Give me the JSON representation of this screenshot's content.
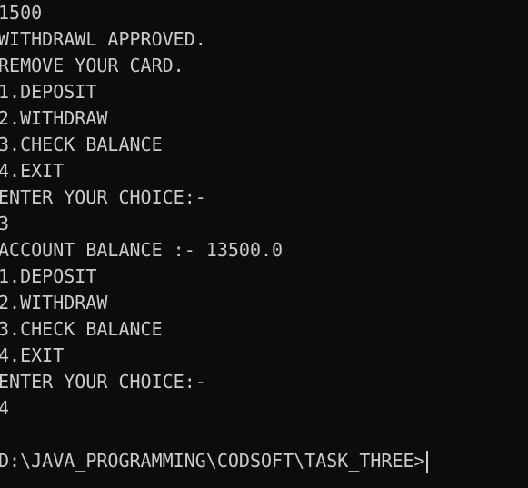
{
  "terminal": {
    "lines_before_prompt": [
      "1500",
      "WITHDRAWL APPROVED.",
      "REMOVE YOUR CARD.",
      "1.DEPOSIT",
      "2.WITHDRAW",
      "3.CHECK BALANCE",
      "4.EXIT",
      "ENTER YOUR CHOICE:-",
      "3",
      "ACCOUNT BALANCE :- 13500.0",
      "1.DEPOSIT",
      "2.WITHDRAW",
      "3.CHECK BALANCE",
      "4.EXIT",
      "ENTER YOUR CHOICE:-",
      "4",
      ""
    ],
    "prompt": "D:\\JAVA_PROGRAMMING\\CODSOFT\\TASK_THREE>"
  },
  "colors": {
    "background": "#0c0c0c",
    "foreground": "#cccccc"
  }
}
